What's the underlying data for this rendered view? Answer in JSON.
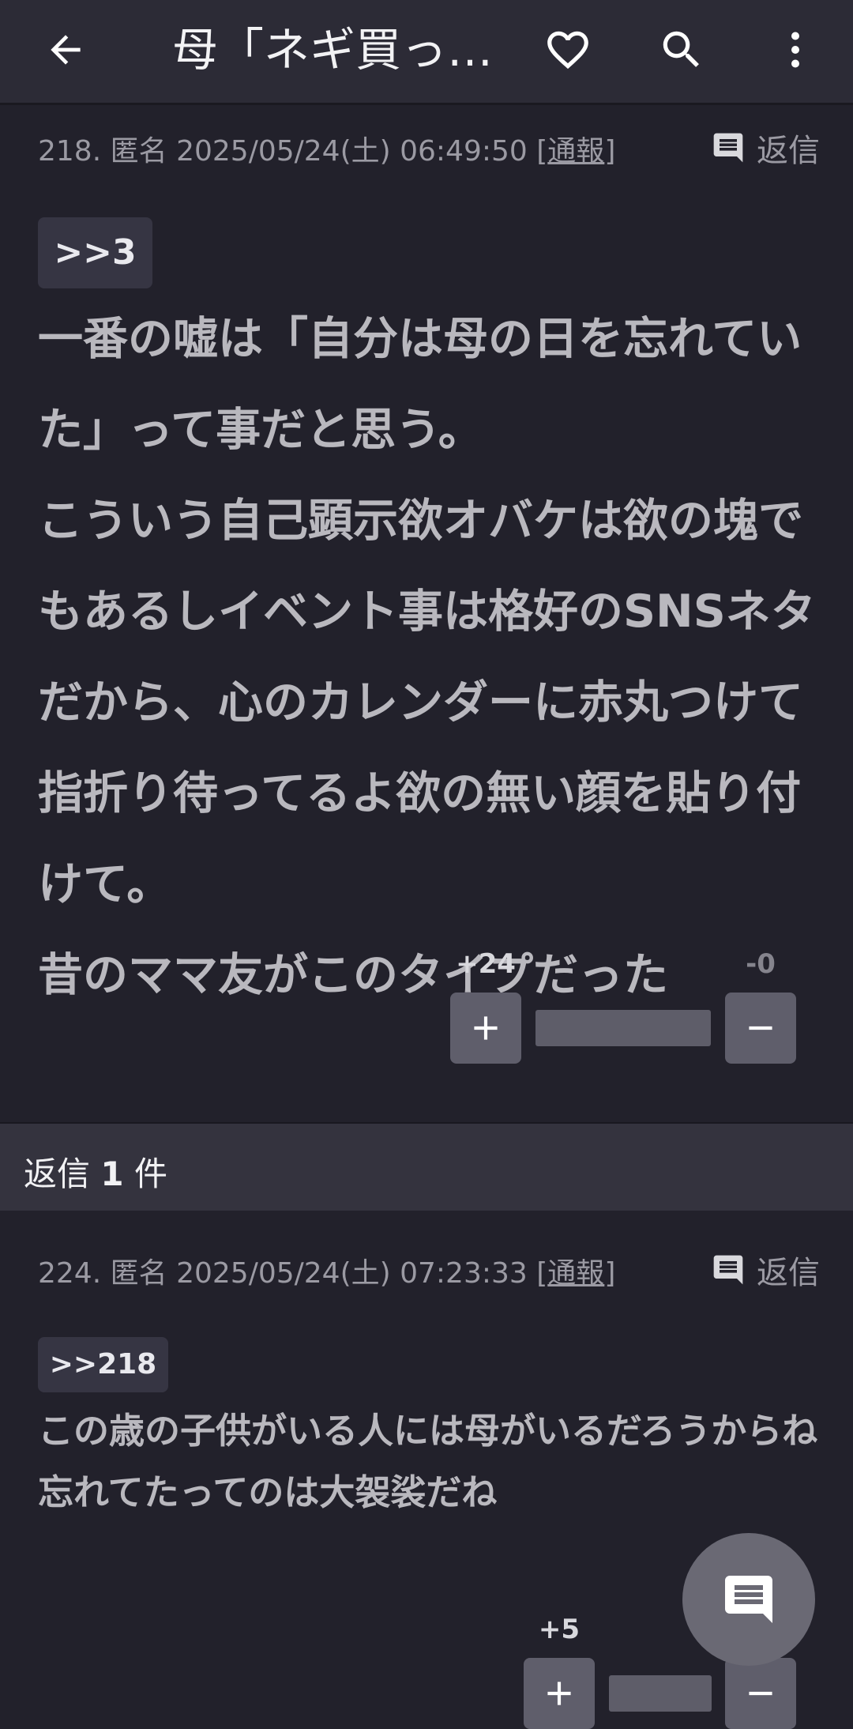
{
  "header": {
    "title": "母「ネギ買っ…",
    "back_icon": "arrow-left-icon",
    "favorite_icon": "heart-outline-icon",
    "search_icon": "search-icon",
    "more_icon": "more-vertical-icon"
  },
  "posts": [
    {
      "number": "218.",
      "name": "匿名",
      "datetime": "2025/05/24(土) 06:49:50",
      "report_label": "通報",
      "reply_label": "返信",
      "anchor": ">>3",
      "body": "一番の嘘は「自分は母の日を忘れていた」って事だと思う。\nこういう自己顕示欲オバケは欲の塊でもあるしイベント事は格好のSNSネタだから、心のカレンダーに赤丸つけて指折り待ってるよ欲の無い顔を貼り付けて。\n昔のママ友がこのタイプだった",
      "plus_count": "+24",
      "minus_count": "-0",
      "plus_ratio": 1.0
    },
    {
      "number": "224.",
      "name": "匿名",
      "datetime": "2025/05/24(土) 07:23:33",
      "report_label": "通報",
      "reply_label": "返信",
      "anchor": ">>218",
      "body": "この歳の子供がいる人には母がいるだろうからね\n忘れてたってのは大袈裟だね",
      "plus_count": "+5",
      "minus_count": "",
      "plus_ratio": 1.0
    }
  ],
  "replies_section": {
    "prefix": "返信",
    "count": "1",
    "suffix": "件"
  },
  "fab": {
    "icon": "comment-icon"
  },
  "colors": {
    "background": "#22212b",
    "header": "#2c2b36",
    "section_bar": "#34333e",
    "vote_button": "#5f5e6b",
    "fab": "#6a6974"
  }
}
